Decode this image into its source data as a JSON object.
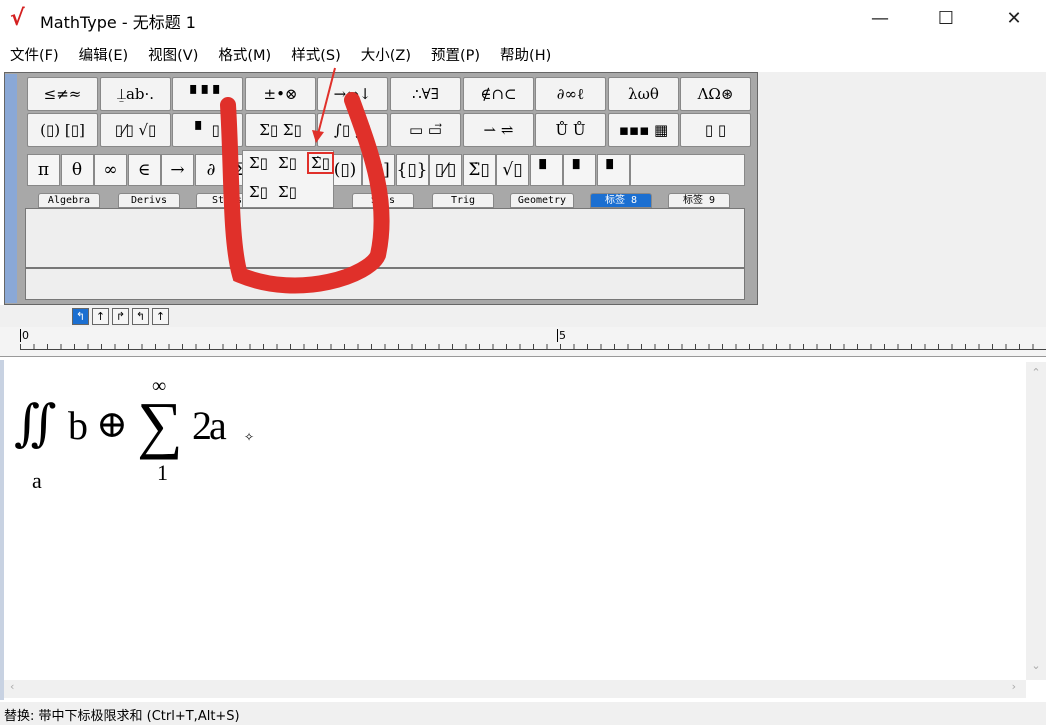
{
  "window": {
    "title": "MathType - 无标题 1",
    "minimize": "—",
    "maximize": "☐",
    "close": "✕"
  },
  "menu": [
    "文件(F)",
    "编辑(E)",
    "视图(V)",
    "格式(M)",
    "样式(S)",
    "大小(Z)",
    "预置(P)",
    "帮助(H)"
  ],
  "toolbar_row1": [
    "≤≠≈",
    "⍊ab·.",
    "▘▘▘",
    "±•⊗",
    "→⇔↓",
    "∴∀∃",
    "∉∩⊂",
    "∂∞ℓ",
    "λωθ",
    "ΛΩ⊛"
  ],
  "toolbar_row2": [
    "(▯) [▯]",
    "▯⁄▯ √▯",
    "▘ ▯",
    "Σ▯ Σ▯",
    "∫▯ ∮▯",
    "▭ ▭⃗",
    "⇀ ⇌",
    "Ů Ů",
    "▪▪▪ ▦",
    "▯ ▯"
  ],
  "palette": [
    "π",
    "θ",
    "∞",
    "∈",
    "→",
    "∂",
    "Σ▯",
    "Σ▯",
    "Σ̇▯",
    "(▯)",
    "[▯]",
    "{▯}",
    "▯⁄▯",
    "Σ̇▯",
    "√▯",
    "▘",
    "▘",
    "▘"
  ],
  "popup_items": [
    "Σ▯",
    "Σ▯",
    "Σ̇▯",
    "Σ▯",
    "Σ▯"
  ],
  "tabs": [
    "Algebra",
    "Derivs",
    "Stats",
    "Sets",
    "Trig",
    "Geometry",
    "标签 8",
    "标签 9"
  ],
  "active_tab": "标签 8",
  "tab_buttons": [
    "↰",
    "↑",
    "↱",
    "↰",
    "↑"
  ],
  "ruler": {
    "mark0": "0",
    "mark5": "5"
  },
  "equation": {
    "integral": "∬",
    "lower_a": "a",
    "b": "b",
    "oplus": "⊕",
    "sum": "∑",
    "upper": "∞",
    "lower": "1",
    "body": "2a"
  },
  "status": "替换: 带中下标极限求和 (Ctrl+T,Alt+S)",
  "annotation_color": "#e0302a"
}
